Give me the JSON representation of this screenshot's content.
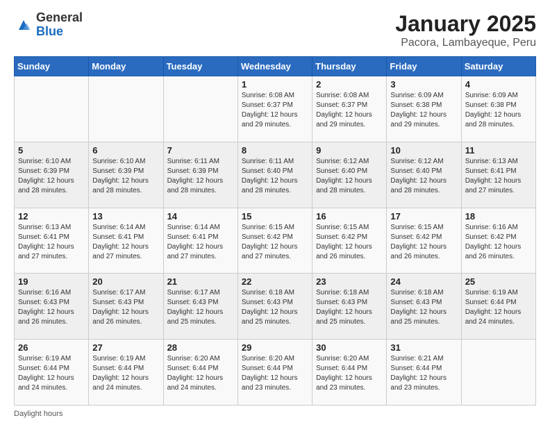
{
  "logo": {
    "general": "General",
    "blue": "Blue"
  },
  "title": "January 2025",
  "subtitle": "Pacora, Lambayeque, Peru",
  "days_of_week": [
    "Sunday",
    "Monday",
    "Tuesday",
    "Wednesday",
    "Thursday",
    "Friday",
    "Saturday"
  ],
  "footer": "Daylight hours",
  "weeks": [
    [
      {
        "day": "",
        "sunrise": "",
        "sunset": "",
        "daylight": ""
      },
      {
        "day": "",
        "sunrise": "",
        "sunset": "",
        "daylight": ""
      },
      {
        "day": "",
        "sunrise": "",
        "sunset": "",
        "daylight": ""
      },
      {
        "day": "1",
        "sunrise": "Sunrise: 6:08 AM",
        "sunset": "Sunset: 6:37 PM",
        "daylight": "Daylight: 12 hours and 29 minutes."
      },
      {
        "day": "2",
        "sunrise": "Sunrise: 6:08 AM",
        "sunset": "Sunset: 6:37 PM",
        "daylight": "Daylight: 12 hours and 29 minutes."
      },
      {
        "day": "3",
        "sunrise": "Sunrise: 6:09 AM",
        "sunset": "Sunset: 6:38 PM",
        "daylight": "Daylight: 12 hours and 29 minutes."
      },
      {
        "day": "4",
        "sunrise": "Sunrise: 6:09 AM",
        "sunset": "Sunset: 6:38 PM",
        "daylight": "Daylight: 12 hours and 28 minutes."
      }
    ],
    [
      {
        "day": "5",
        "sunrise": "Sunrise: 6:10 AM",
        "sunset": "Sunset: 6:39 PM",
        "daylight": "Daylight: 12 hours and 28 minutes."
      },
      {
        "day": "6",
        "sunrise": "Sunrise: 6:10 AM",
        "sunset": "Sunset: 6:39 PM",
        "daylight": "Daylight: 12 hours and 28 minutes."
      },
      {
        "day": "7",
        "sunrise": "Sunrise: 6:11 AM",
        "sunset": "Sunset: 6:39 PM",
        "daylight": "Daylight: 12 hours and 28 minutes."
      },
      {
        "day": "8",
        "sunrise": "Sunrise: 6:11 AM",
        "sunset": "Sunset: 6:40 PM",
        "daylight": "Daylight: 12 hours and 28 minutes."
      },
      {
        "day": "9",
        "sunrise": "Sunrise: 6:12 AM",
        "sunset": "Sunset: 6:40 PM",
        "daylight": "Daylight: 12 hours and 28 minutes."
      },
      {
        "day": "10",
        "sunrise": "Sunrise: 6:12 AM",
        "sunset": "Sunset: 6:40 PM",
        "daylight": "Daylight: 12 hours and 28 minutes."
      },
      {
        "day": "11",
        "sunrise": "Sunrise: 6:13 AM",
        "sunset": "Sunset: 6:41 PM",
        "daylight": "Daylight: 12 hours and 27 minutes."
      }
    ],
    [
      {
        "day": "12",
        "sunrise": "Sunrise: 6:13 AM",
        "sunset": "Sunset: 6:41 PM",
        "daylight": "Daylight: 12 hours and 27 minutes."
      },
      {
        "day": "13",
        "sunrise": "Sunrise: 6:14 AM",
        "sunset": "Sunset: 6:41 PM",
        "daylight": "Daylight: 12 hours and 27 minutes."
      },
      {
        "day": "14",
        "sunrise": "Sunrise: 6:14 AM",
        "sunset": "Sunset: 6:41 PM",
        "daylight": "Daylight: 12 hours and 27 minutes."
      },
      {
        "day": "15",
        "sunrise": "Sunrise: 6:15 AM",
        "sunset": "Sunset: 6:42 PM",
        "daylight": "Daylight: 12 hours and 27 minutes."
      },
      {
        "day": "16",
        "sunrise": "Sunrise: 6:15 AM",
        "sunset": "Sunset: 6:42 PM",
        "daylight": "Daylight: 12 hours and 26 minutes."
      },
      {
        "day": "17",
        "sunrise": "Sunrise: 6:15 AM",
        "sunset": "Sunset: 6:42 PM",
        "daylight": "Daylight: 12 hours and 26 minutes."
      },
      {
        "day": "18",
        "sunrise": "Sunrise: 6:16 AM",
        "sunset": "Sunset: 6:42 PM",
        "daylight": "Daylight: 12 hours and 26 minutes."
      }
    ],
    [
      {
        "day": "19",
        "sunrise": "Sunrise: 6:16 AM",
        "sunset": "Sunset: 6:43 PM",
        "daylight": "Daylight: 12 hours and 26 minutes."
      },
      {
        "day": "20",
        "sunrise": "Sunrise: 6:17 AM",
        "sunset": "Sunset: 6:43 PM",
        "daylight": "Daylight: 12 hours and 26 minutes."
      },
      {
        "day": "21",
        "sunrise": "Sunrise: 6:17 AM",
        "sunset": "Sunset: 6:43 PM",
        "daylight": "Daylight: 12 hours and 25 minutes."
      },
      {
        "day": "22",
        "sunrise": "Sunrise: 6:18 AM",
        "sunset": "Sunset: 6:43 PM",
        "daylight": "Daylight: 12 hours and 25 minutes."
      },
      {
        "day": "23",
        "sunrise": "Sunrise: 6:18 AM",
        "sunset": "Sunset: 6:43 PM",
        "daylight": "Daylight: 12 hours and 25 minutes."
      },
      {
        "day": "24",
        "sunrise": "Sunrise: 6:18 AM",
        "sunset": "Sunset: 6:43 PM",
        "daylight": "Daylight: 12 hours and 25 minutes."
      },
      {
        "day": "25",
        "sunrise": "Sunrise: 6:19 AM",
        "sunset": "Sunset: 6:44 PM",
        "daylight": "Daylight: 12 hours and 24 minutes."
      }
    ],
    [
      {
        "day": "26",
        "sunrise": "Sunrise: 6:19 AM",
        "sunset": "Sunset: 6:44 PM",
        "daylight": "Daylight: 12 hours and 24 minutes."
      },
      {
        "day": "27",
        "sunrise": "Sunrise: 6:19 AM",
        "sunset": "Sunset: 6:44 PM",
        "daylight": "Daylight: 12 hours and 24 minutes."
      },
      {
        "day": "28",
        "sunrise": "Sunrise: 6:20 AM",
        "sunset": "Sunset: 6:44 PM",
        "daylight": "Daylight: 12 hours and 24 minutes."
      },
      {
        "day": "29",
        "sunrise": "Sunrise: 6:20 AM",
        "sunset": "Sunset: 6:44 PM",
        "daylight": "Daylight: 12 hours and 23 minutes."
      },
      {
        "day": "30",
        "sunrise": "Sunrise: 6:20 AM",
        "sunset": "Sunset: 6:44 PM",
        "daylight": "Daylight: 12 hours and 23 minutes."
      },
      {
        "day": "31",
        "sunrise": "Sunrise: 6:21 AM",
        "sunset": "Sunset: 6:44 PM",
        "daylight": "Daylight: 12 hours and 23 minutes."
      },
      {
        "day": "",
        "sunrise": "",
        "sunset": "",
        "daylight": ""
      }
    ]
  ]
}
